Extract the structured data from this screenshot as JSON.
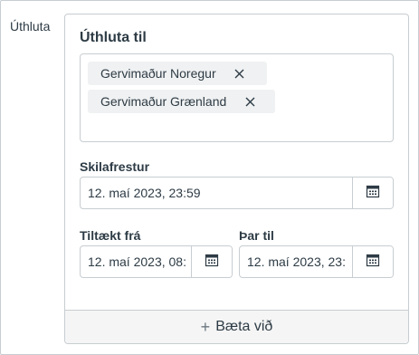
{
  "side_label": "Úthluta",
  "card": {
    "title": "Úthluta til",
    "assignees": [
      {
        "name": "Gervimaður Noregur"
      },
      {
        "name": "Gervimaður Grænland"
      }
    ],
    "due": {
      "label": "Skilafrestur",
      "value": "12. maí 2023, 23:59"
    },
    "available_from": {
      "label": "Tiltækt frá",
      "value": "12. maí 2023, 08:"
    },
    "until": {
      "label": "Þar til",
      "value": "12. maí 2023, 23:"
    },
    "add_label": "Bæta við"
  },
  "icons": {
    "remove": "close-icon",
    "calendar": "calendar-icon",
    "add": "plus-icon"
  }
}
